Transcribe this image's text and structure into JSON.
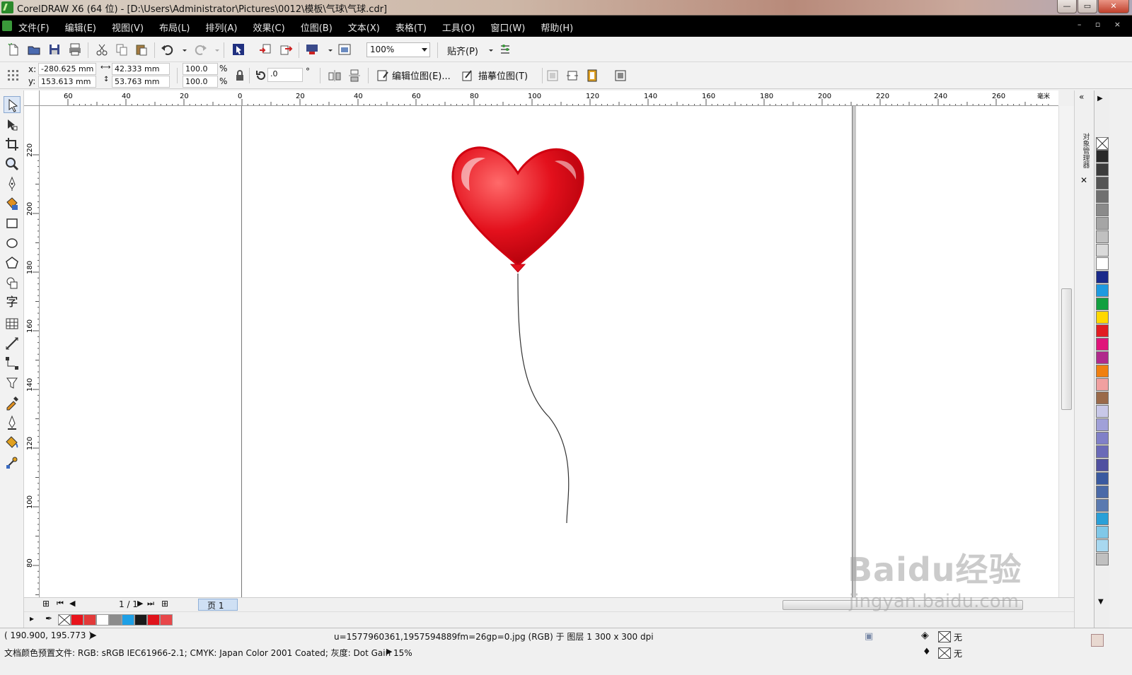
{
  "window": {
    "title": "CorelDRAW X6 (64 位) - [D:\\Users\\Administrator\\Pictures\\0012\\模板\\气球\\气球.cdr]",
    "buttons": [
      "—",
      "▭",
      "✕"
    ]
  },
  "menu": {
    "items": [
      "文件(F)",
      "编辑(E)",
      "视图(V)",
      "布局(L)",
      "排列(A)",
      "效果(C)",
      "位图(B)",
      "文本(X)",
      "表格(T)",
      "工具(O)",
      "窗口(W)",
      "帮助(H)"
    ],
    "doc_controls": "– ▫ ×"
  },
  "toolbar": {
    "zoom": "100%",
    "snap_label": "贴齐(P)"
  },
  "propbar": {
    "x_label": "x:",
    "x_value": "-280.625 mm",
    "y_label": "y:",
    "y_value": "153.613 mm",
    "width": "42.333 mm",
    "height": "53.763 mm",
    "scale_x": "100.0",
    "scale_y": "100.0",
    "pct1": "%",
    "pct2": "%",
    "rotation": ".0",
    "deg": "°",
    "edit_bitmap": "编辑位图(E)...",
    "trace_bitmap": "描摹位图(T)"
  },
  "ruler": {
    "h_labels": [
      "60",
      "40",
      "20",
      "0",
      "20",
      "40",
      "60",
      "80",
      "100",
      "120",
      "140",
      "160",
      "180",
      "200",
      "220",
      "240",
      "260"
    ],
    "v_labels": [
      "220",
      "200",
      "180",
      "160",
      "140",
      "120",
      "100",
      "80"
    ],
    "unit": "毫米"
  },
  "pagenav": {
    "count": "1 / 1",
    "page_tab": "页 1"
  },
  "recent_colors": [
    "#e8141c",
    "#e23a3a",
    "#ffffff",
    "#8c8c8c",
    "#1ea0e6",
    "#1a1a1a",
    "#e0141c",
    "#e8474a"
  ],
  "palette_colors": [
    "#2a2a2a",
    "#3c3c3c",
    "#555555",
    "#707070",
    "#8a8a8a",
    "#a5a5a5",
    "#c0c0c0",
    "#dadada",
    "#ffffff",
    "#1a2a8a",
    "#1e9ae0",
    "#12a040",
    "#ffd800",
    "#e21c22",
    "#e0147a",
    "#b02a8c",
    "#f08010",
    "#f0a0a0",
    "#9a6a4a",
    "#c8c8e8",
    "#a0a0d8",
    "#8080c8",
    "#6a6ab8",
    "#5050a0",
    "#3a5aa0",
    "#4a6aa8",
    "#5a7ab0",
    "#2aa0d8",
    "#80c8e8",
    "#a8d8f0",
    "#c0c0c0"
  ],
  "docker": {
    "title": "对象管理器"
  },
  "status": {
    "coords": "( 190.900, 195.773 )",
    "object_info": "u=1577960361,1957594889fm=26gp=0.jpg (RGB) 于 图层 1 300 x 300 dpi",
    "profile": "文档颜色预置文件: RGB: sRGB IEC61966-2.1; CMYK: Japan Color 2001 Coated; 灰度: Dot Gain 15%",
    "fill": "无",
    "outline": "无"
  },
  "watermark": {
    "brand": "Baidu经验",
    "url": "jingyan.baidu.com"
  },
  "colors": {
    "heart_red": "#e3101c",
    "annotation_arrow": "#1020e0",
    "menubar_bg": "#000000"
  }
}
